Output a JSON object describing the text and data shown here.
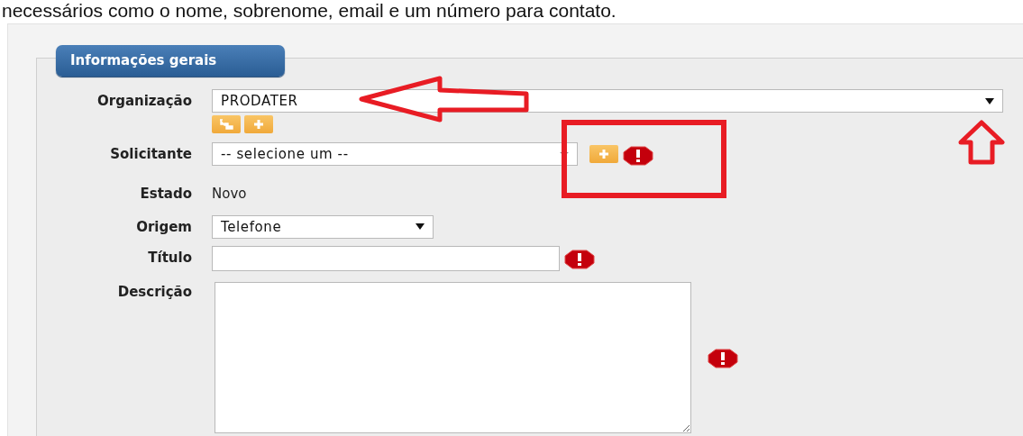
{
  "intro_text": "necessários como o nome, sobrenome, email e um número para contato.",
  "section": {
    "title": "Informações gerais"
  },
  "fields": [
    {
      "kind": "wide_select",
      "label": "Organização",
      "value": "PRODATER",
      "actions": [
        {
          "kind": "tree"
        },
        {
          "kind": "add"
        }
      ],
      "required": false
    },
    {
      "kind": "select",
      "label": "Solicitante",
      "value": "-- selecione um --",
      "actions": [
        {
          "kind": "add"
        }
      ],
      "required": true
    },
    {
      "kind": "static",
      "label": "Estado",
      "value": "Novo",
      "required": false
    },
    {
      "kind": "select",
      "label": "Origem",
      "value": "Telefone",
      "required": false
    },
    {
      "kind": "text",
      "label": "Título",
      "required": true
    },
    {
      "kind": "textarea",
      "label": "Descrição",
      "required": true
    }
  ]
}
